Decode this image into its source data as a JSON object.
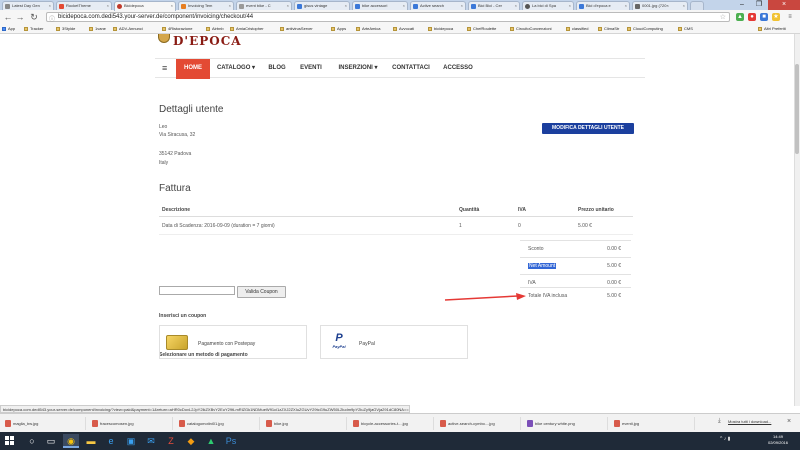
{
  "browser": {
    "tabs": [
      {
        "title": "Latest Day Gen"
      },
      {
        "title": "RocketTheme"
      },
      {
        "title": "Bicidepoca"
      },
      {
        "title": "Invoicing Tem"
      },
      {
        "title": "event bike - C"
      },
      {
        "title": "gisus vintage"
      },
      {
        "title": "bike accessori"
      },
      {
        "title": "Active search"
      },
      {
        "title": "Bici Bici - Cer"
      },
      {
        "title": "La bici di Spa"
      },
      {
        "title": "Bici d'epoca e"
      },
      {
        "title": "0001.jpg (720×"
      }
    ],
    "url": "bicidepoca.com.dedi543.your-server.de/component/invoicing/checkout/44",
    "bookmarks": [
      {
        "label": "App",
        "type": "app"
      },
      {
        "label": "Tracker"
      },
      {
        "label": "3Stylde"
      },
      {
        "label": "1vane"
      },
      {
        "label": "ADV-Annunci"
      },
      {
        "label": "4Ristorazione"
      },
      {
        "label": "Airbnb"
      },
      {
        "label": "AmiaCristopher"
      },
      {
        "label": "antivirusServer"
      },
      {
        "label": "Apps"
      },
      {
        "label": "ArteAmica"
      },
      {
        "label": "Avvocati"
      },
      {
        "label": "bicidepoca"
      },
      {
        "label": "ChefRoulette"
      },
      {
        "label": "CircuitoConvenzioni"
      },
      {
        "label": "classified"
      },
      {
        "label": "ClimaStr"
      },
      {
        "label": "CloudComputing"
      },
      {
        "label": "CMS"
      }
    ],
    "other_bookmarks": "Altri Preferiti",
    "status_url": "bicidepoca.com.dedi543.your-server.de/component/invoicing/?view=paid&payment=1&return=aHR0cDovL2JpY2lkZXBvY2EuY29tLmRlZGk1NDMueW91ci1zZXJ2ZXIuZGUvY29tcG9uZW50L2ludm9pY2luZy9jaGVja291dC80NA=="
  },
  "site": {
    "logo": "D'EPOCA",
    "nav": [
      {
        "label": "HOME",
        "active": true
      },
      {
        "label": "CATALOGO ▾"
      },
      {
        "label": "BLOG"
      },
      {
        "label": "EVENTI"
      },
      {
        "label": "INSERZIONI ▾"
      },
      {
        "label": "CONTATTACI"
      },
      {
        "label": "ACCESSO"
      }
    ]
  },
  "user_details": {
    "heading": "Dettagli utente",
    "name": "Leo",
    "street": "Via Siracusa, 32",
    "city": "35142 Padova",
    "country": "Italy",
    "edit_button": "MODIFICA DETTAGLI UTENTE"
  },
  "invoice": {
    "heading": "Fattura",
    "columns": [
      "Descrizione",
      "Quantità",
      "IVA",
      "Prezzo unitario"
    ],
    "rows": [
      {
        "description": "Data di Scadenza: 2016-09-09 (duration = 7 giorni)",
        "quantity": "1",
        "vat": "0",
        "unit_price": "5.00 €"
      }
    ],
    "summary": [
      {
        "label": "Sconto",
        "value": "0.00 €"
      },
      {
        "label": "Net Amount",
        "value": "5.00 €",
        "highlighted": true
      },
      {
        "label": "IVA",
        "value": "0.00 €"
      },
      {
        "label": "Totale IVA inclusa",
        "value": "5.00 €"
      }
    ]
  },
  "coupon": {
    "label": "Inserisci un coupon",
    "value": "",
    "button": "Valida Coupon"
  },
  "payment": {
    "label": "Selezionare un metodo di pagamento",
    "methods": [
      {
        "label": "Pagamento con Postepay"
      },
      {
        "label": "PayPal"
      }
    ]
  },
  "downloads": {
    "items": [
      {
        "name": "maglia_bw.jpg"
      },
      {
        "name": "fracescomosen.jpg"
      },
      {
        "name": "catalogomotini01.jpg"
      },
      {
        "name": "bike.jpg"
      },
      {
        "name": "bicycle-accessories-t....jpg"
      },
      {
        "name": "active-search-cymbo....jpg"
      },
      {
        "name": "bike century white.png"
      },
      {
        "name": "eventi.jpg"
      }
    ],
    "show_all": "Mostra tutti i download..."
  },
  "taskbar": {
    "time": "14:49",
    "date": "02/09/2016"
  }
}
